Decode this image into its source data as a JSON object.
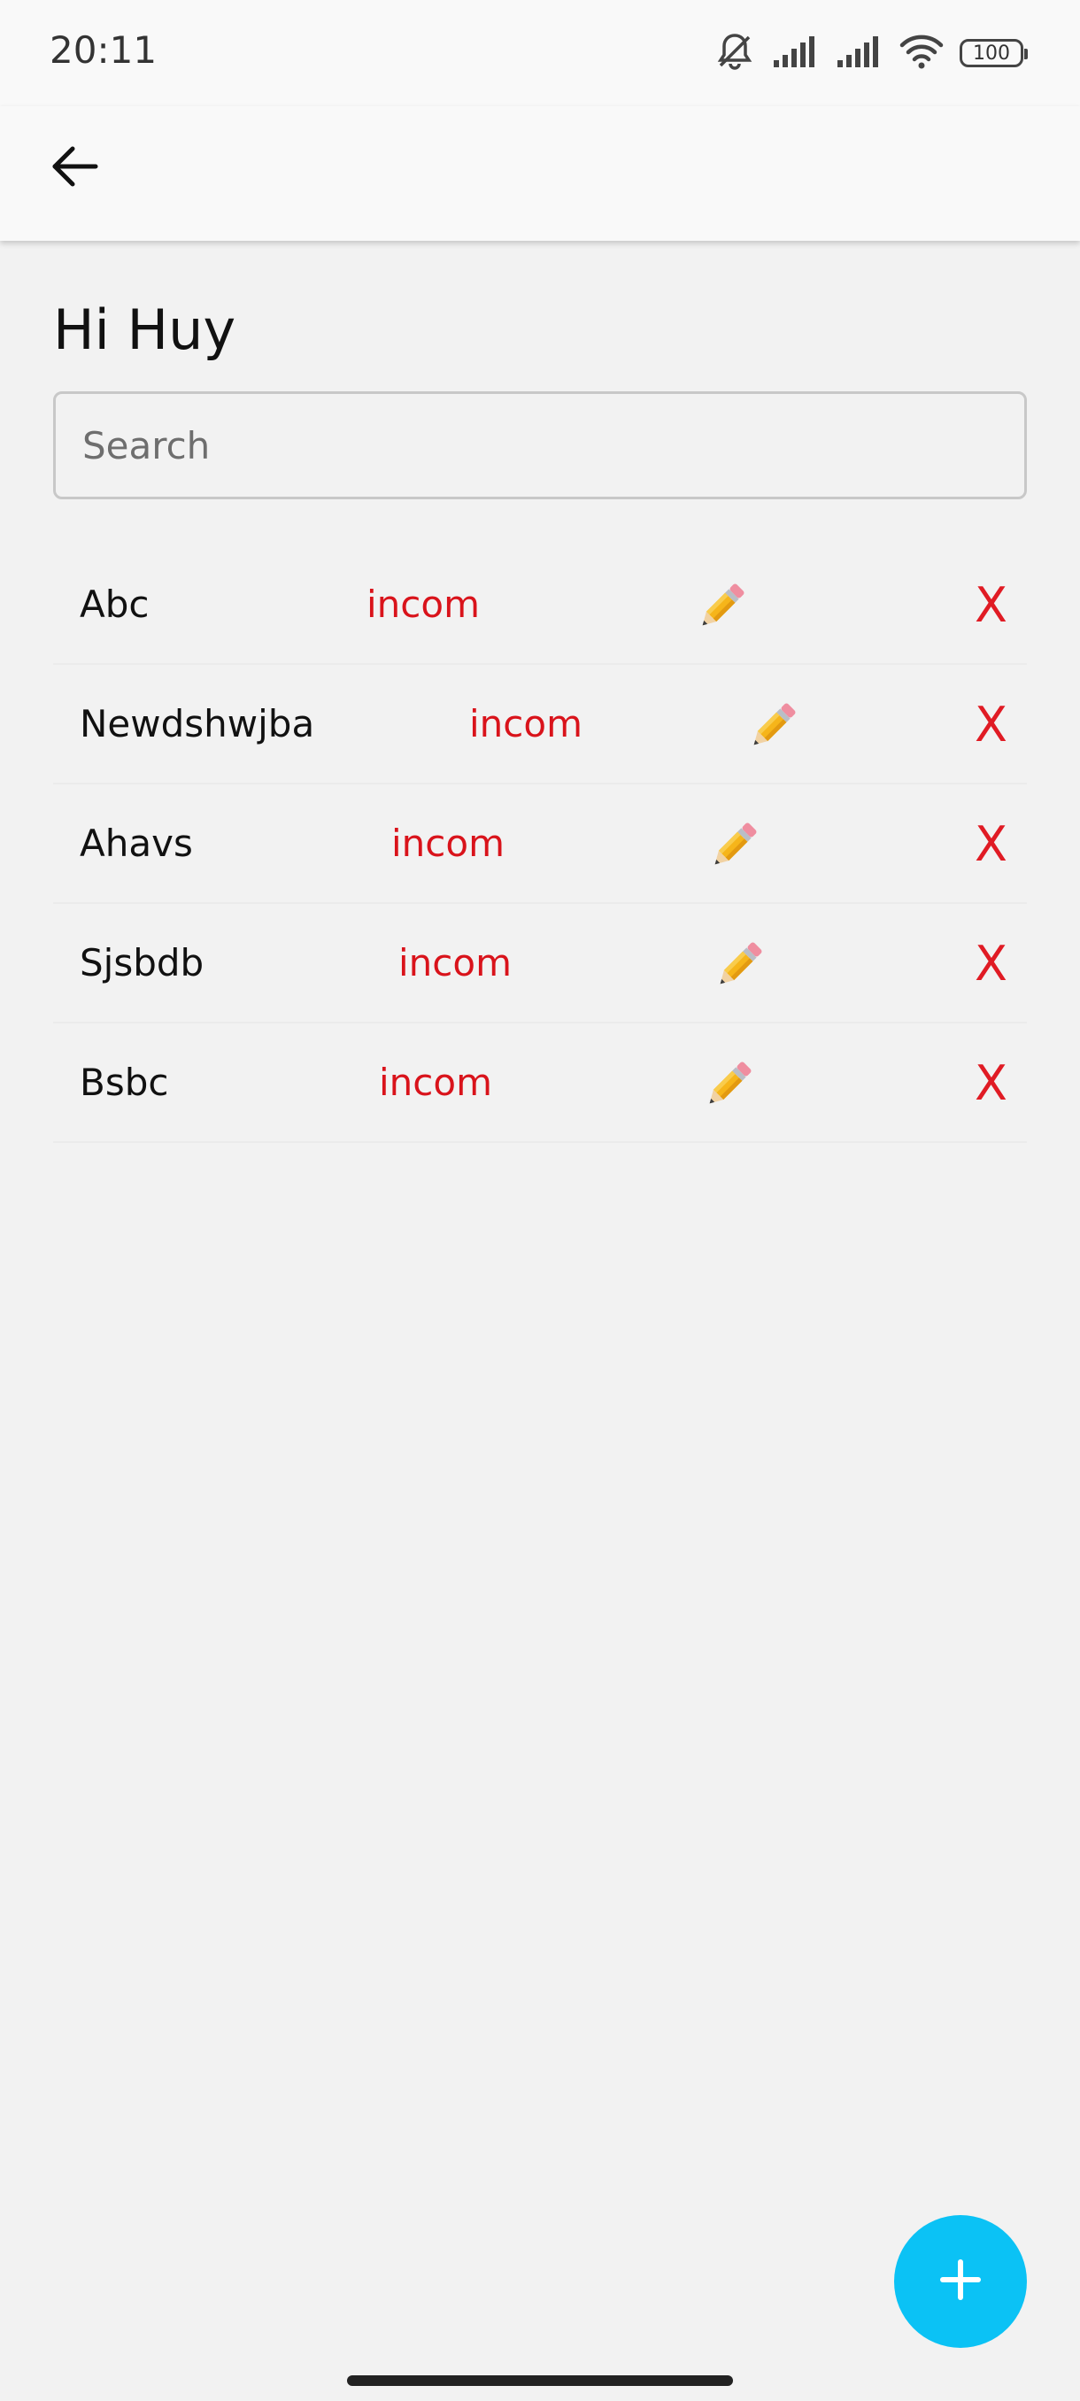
{
  "status_bar": {
    "time": "20:11",
    "battery_level": "100",
    "icons": [
      "mute-icon",
      "signal-icon",
      "signal-icon",
      "wifi-icon",
      "battery-icon"
    ]
  },
  "app_bar": {
    "back_icon": "arrow-left-icon"
  },
  "greeting": "Hi Huy",
  "search": {
    "placeholder": "Search",
    "value": ""
  },
  "items": [
    {
      "name": "Abc",
      "type": "incom"
    },
    {
      "name": "Newdshwjba",
      "type": "incom"
    },
    {
      "name": "Ahavs",
      "type": "incom"
    },
    {
      "name": "Sjsbdb",
      "type": "incom"
    },
    {
      "name": "Bsbc",
      "type": "incom"
    }
  ],
  "delete_label": "X",
  "fab_icon": "plus-icon",
  "colors": {
    "accent": "#0bc2f5",
    "type_text": "#d9131b",
    "delete": "#e01b24",
    "background": "#f2f2f2"
  }
}
